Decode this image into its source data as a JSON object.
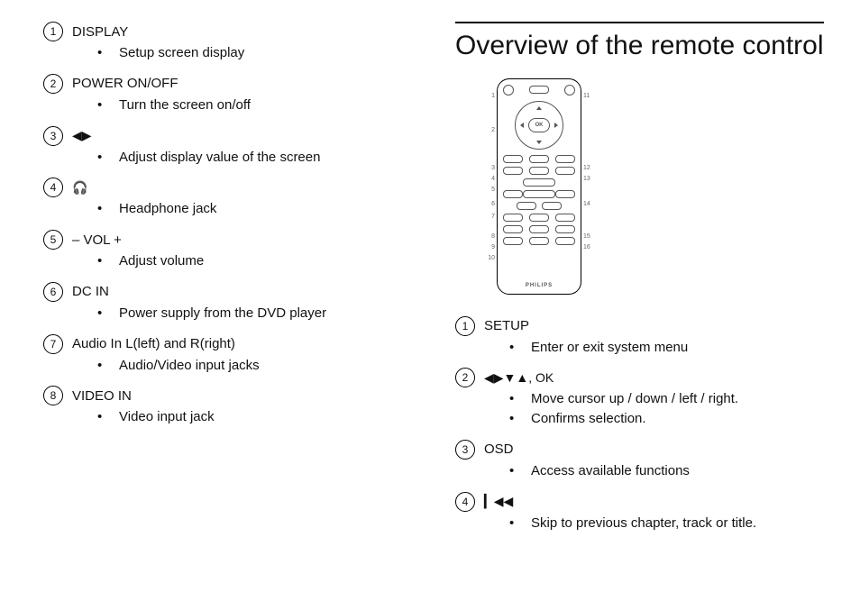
{
  "left": {
    "items": [
      {
        "num": "1",
        "title": "DISPLAY",
        "iconText": "",
        "bullets": [
          "Setup screen display"
        ]
      },
      {
        "num": "2",
        "title": "POWER ON/OFF",
        "iconText": "",
        "bullets": [
          "Turn the screen on/off"
        ]
      },
      {
        "num": "3",
        "title": "",
        "iconText": "◀▶",
        "bullets": [
          "Adjust display value of the screen"
        ]
      },
      {
        "num": "4",
        "title": "",
        "iconText": "🎧",
        "bullets": [
          "Headphone jack"
        ]
      },
      {
        "num": "5",
        "title": "– VOL +",
        "iconText": "",
        "bullets": [
          "Adjust volume"
        ]
      },
      {
        "num": "6",
        "title": "DC IN",
        "iconText": "",
        "bullets": [
          "Power supply from the DVD player"
        ]
      },
      {
        "num": "7",
        "title": "Audio In L(left) and R(right)",
        "iconText": "",
        "bullets": [
          "Audio/Video input jacks"
        ]
      },
      {
        "num": "8",
        "title": "VIDEO IN",
        "iconText": "",
        "bullets": [
          "Video input jack"
        ]
      }
    ]
  },
  "right": {
    "heading": "Overview of the remote control",
    "remoteCallouts": {
      "left": [
        "1",
        "2",
        "3",
        "4",
        "5",
        "6",
        "7",
        "8",
        "9",
        "10"
      ],
      "right": [
        "11",
        "12",
        "13",
        "14",
        "15",
        "16"
      ]
    },
    "okLabel": "OK",
    "brand": "PHILIPS",
    "items": [
      {
        "num": "1",
        "title": "SETUP",
        "iconText": "",
        "bullets": [
          "Enter or exit system menu"
        ]
      },
      {
        "num": "2",
        "title": "",
        "iconText": "◀▶▼▲, OK",
        "bullets": [
          "Move cursor up / down / left / right.",
          "Confirms selection."
        ]
      },
      {
        "num": "3",
        "title": "OSD",
        "iconText": "",
        "bullets": [
          "Access available functions"
        ]
      },
      {
        "num": "4",
        "title": "",
        "iconText": "▎◀◀",
        "bullets": [
          "Skip to previous chapter, track or title."
        ]
      }
    ]
  }
}
